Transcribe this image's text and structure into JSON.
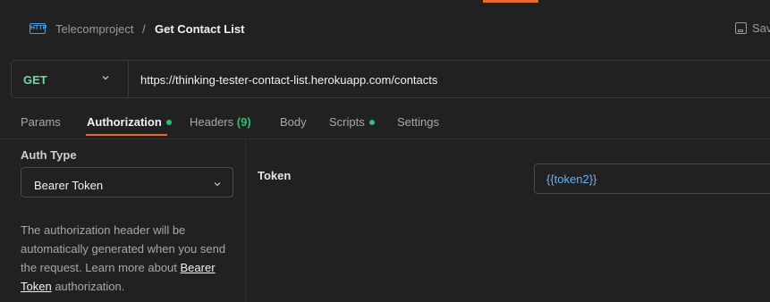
{
  "header": {
    "protocol_icon": "HTTP",
    "collection": "Telecomproject",
    "separator": "/",
    "request_name": "Get Contact List",
    "save_label": "Save"
  },
  "request": {
    "method": "GET",
    "url": "https://thinking-tester-contact-list.herokuapp.com/contacts"
  },
  "tabs": {
    "params": "Params",
    "authorization": "Authorization",
    "headers": "Headers",
    "headers_count": "(9)",
    "body": "Body",
    "scripts": "Scripts",
    "settings": "Settings"
  },
  "auth": {
    "type_label": "Auth Type",
    "type_value": "Bearer Token",
    "help_text": "The authorization header will be automatically generated when you send the request. Learn more about",
    "help_link": "Bearer Token",
    "help_suffix": "authorization."
  },
  "token": {
    "label": "Token",
    "value": "{{token2}}"
  },
  "colors": {
    "accent": "#e8692c",
    "method_get": "#6bdd9a",
    "indicator_dot": "#2fbf71",
    "variable": "#6ab0f3",
    "background": "#212121"
  }
}
